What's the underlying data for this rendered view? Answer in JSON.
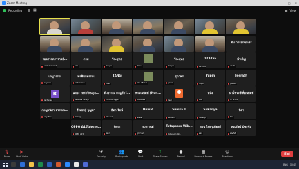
{
  "window": {
    "title": "Zoom Meeting",
    "controls": [
      "–",
      "□",
      "✕"
    ]
  },
  "topbar": {
    "meeting_label": "Recording",
    "view_label": "View"
  },
  "participants": [
    {
      "type": "video",
      "style": "a",
      "body": "w",
      "caption": "",
      "active": true
    },
    {
      "type": "video",
      "style": "b",
      "body": "r",
      "caption": ""
    },
    {
      "type": "video",
      "style": "c",
      "body": "",
      "caption": ""
    },
    {
      "type": "video",
      "style": "d",
      "body": "",
      "caption": ""
    },
    {
      "type": "video",
      "style": "e",
      "body": "",
      "caption": ""
    },
    {
      "type": "video",
      "style": "b",
      "body": "y",
      "caption": ""
    },
    {
      "type": "video",
      "style": "a",
      "body": "y",
      "caption": ""
    },
    {
      "type": "video",
      "style": "c",
      "body": "",
      "caption": ""
    },
    {
      "type": "video",
      "style": "d",
      "body": "",
      "caption": ""
    },
    {
      "type": "video",
      "style": "e",
      "body": "y",
      "caption": ""
    },
    {
      "type": "video",
      "style": "a",
      "body": "",
      "caption": ""
    },
    {
      "type": "video",
      "style": "b",
      "body": "",
      "caption": ""
    },
    {
      "type": "video",
      "style": "c",
      "body": "",
      "caption": ""
    },
    {
      "type": "name",
      "name": "ต้น วรรธน์ชนศร",
      "caption": ""
    },
    {
      "type": "name",
      "name": "รองศาสตราจารย์...",
      "caption": "รองศาสตราจารย์"
    },
    {
      "type": "name",
      "name": "ภาพ",
      "caption": "ภาพ"
    },
    {
      "type": "name",
      "name": "วีระยุทธ",
      "caption": "วีระยุทธ"
    },
    {
      "type": "thumb",
      "name": "",
      "caption": "ชัยชนะ"
    },
    {
      "type": "name",
      "name": "วีระยุทธ",
      "caption": "วีระยุทธ"
    },
    {
      "type": "name",
      "name": "123456",
      "caption": "123456"
    },
    {
      "type": "name",
      "name": "น้ำเพ็ญ",
      "caption": "น้ำเพ็ญ"
    },
    {
      "type": "name",
      "name": "เรณูวรรณ",
      "caption": "เรณูวรรณ"
    },
    {
      "type": "name",
      "name": "พรพิมลพรรณ",
      "caption": "พรพิมลพรรณ"
    },
    {
      "type": "name",
      "name": "TANG",
      "caption": "TANG"
    },
    {
      "type": "thumb",
      "name": "",
      "caption": "นิคม ศรีมาลา"
    },
    {
      "type": "name",
      "name": "สุภาพร",
      "caption": "สุภาพร"
    },
    {
      "type": "name",
      "name": "Yupin",
      "caption": "Yupin"
    },
    {
      "type": "name",
      "name": "Jeerath",
      "caption": "Jeerath"
    },
    {
      "type": "avatar-r",
      "name": "R",
      "caption": "Rachanee"
    },
    {
      "type": "name",
      "name": "ฉลอง เหล่ารัตนกุล...",
      "caption": "ฉลอง เหล่ารัตนกุล"
    },
    {
      "type": "name",
      "name": "ด้วยรรณ เรณูสัตว์...",
      "caption": "ด้วยรรณ เรณูสัตว์"
    },
    {
      "type": "name",
      "name": "พรรณพิมพ์ (Non...",
      "caption": "พรรณพิมพ์"
    },
    {
      "type": "avatar-o",
      "name": "",
      "caption": "User"
    },
    {
      "type": "name",
      "name": "หนิง",
      "caption": "หนิง"
    },
    {
      "type": "name",
      "name": "นาวี่หรรษ์เพื่อนพิมพ์",
      "caption": "นาวี่หรรษ์"
    },
    {
      "type": "name",
      "name": "กาญจนิศา สุวรรณ...",
      "caption": "กาญจนิศา"
    },
    {
      "type": "name",
      "name": "ธีรเชษฐ์ บุญมา",
      "caption": "ธีรเชษฐ์"
    },
    {
      "type": "name",
      "name": "ธิดา รัตน์",
      "caption": "ธิดา รัตน์"
    },
    {
      "type": "name",
      "name": "Nuwat",
      "caption": "Nuwat"
    },
    {
      "type": "name",
      "name": "Sunisa U",
      "caption": "Sunisa U"
    },
    {
      "type": "name",
      "name": "Sukanya",
      "caption": "Sukanya"
    },
    {
      "type": "name",
      "name": "นิสา",
      "caption": "นิสา"
    },
    {
      "type": "empty"
    },
    {
      "type": "name",
      "name": "OPPO A15ไม่ทราบ...",
      "caption": "OPPO A15"
    },
    {
      "type": "name",
      "name": "จิตรา",
      "caption": "จิตรา"
    },
    {
      "type": "name",
      "name": "ศุภกานต์",
      "caption": "ศุภกานต์"
    },
    {
      "type": "name",
      "name": "Tatapoom Wib...",
      "caption": "Tatapoom Wib"
    },
    {
      "type": "name",
      "name": "ตอน ไปคุรุเพียงค์",
      "caption": "ตอน"
    },
    {
      "type": "name",
      "name": "คุณภัทรี มีชะชีล",
      "caption": "คุณภัทรี"
    }
  ],
  "toolbar": {
    "left": [
      {
        "icon": "microphone-icon",
        "label": "Mute"
      },
      {
        "icon": "video-camera-icon",
        "label": "Start Video"
      }
    ],
    "center": [
      {
        "icon": "shield-icon",
        "label": "Security"
      },
      {
        "icon": "participants-icon",
        "label": "Participants"
      },
      {
        "icon": "chat-icon",
        "label": "Chat"
      },
      {
        "icon": "share-screen-icon",
        "label": "Share Screen"
      },
      {
        "icon": "record-icon",
        "label": "Record"
      },
      {
        "icon": "breakout-rooms-icon",
        "label": "Breakout Rooms"
      },
      {
        "icon": "reactions-icon",
        "label": "Reactions"
      }
    ],
    "end_label": "End"
  },
  "taskbar": {
    "tray_time": "10:45",
    "tray_lang": "ENG"
  }
}
